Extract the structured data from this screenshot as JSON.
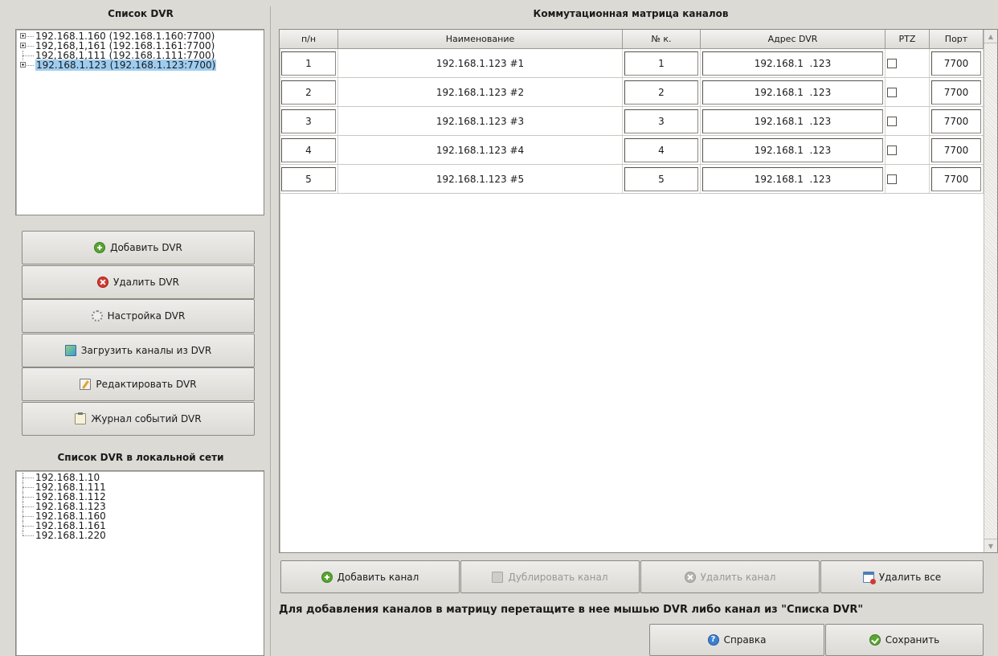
{
  "left": {
    "dvr_list_title": "Список DVR",
    "dvr_tree": [
      {
        "label": "192.168.1.160 (192.168.1.160:7700)",
        "expandable": true,
        "selected": false
      },
      {
        "label": "192,168,1,161 (192.168.1.161:7700)",
        "expandable": true,
        "selected": false
      },
      {
        "label": "192,168,1,111 (192.168.1.111:7700)",
        "expandable": false,
        "selected": false
      },
      {
        "label": "192.168.1.123 (192.168.1.123:7700)",
        "expandable": true,
        "selected": true
      }
    ],
    "buttons": {
      "add": "Добавить DVR",
      "delete": "Удалить DVR",
      "settings": "Настройка DVR",
      "load_channels": "Загрузить каналы из DVR",
      "edit": "Редактировать DVR",
      "event_log": "Журнал событий DVR"
    },
    "local_title": "Список DVR в локальной сети",
    "local_list": [
      "192.168.1.10",
      "192.168.1.111",
      "192.168.1.112",
      "192.168.1.123",
      "192.168.1.160",
      "192.168.1.161",
      "192.168.1.220"
    ]
  },
  "matrix": {
    "title": "Коммутационная матрица каналов",
    "columns": {
      "num": "п/н",
      "name": "Наименование",
      "ch": "№ к.",
      "addr": "Адрес DVR",
      "ptz": "PTZ",
      "port": "Порт"
    },
    "rows": [
      {
        "num": "1",
        "name": "192.168.1.123 #1",
        "ch": "1",
        "addr": "192.168.1  .123",
        "ptz": false,
        "port": "7700"
      },
      {
        "num": "2",
        "name": "192.168.1.123 #2",
        "ch": "2",
        "addr": "192.168.1  .123",
        "ptz": false,
        "port": "7700"
      },
      {
        "num": "3",
        "name": "192.168.1.123 #3",
        "ch": "3",
        "addr": "192.168.1  .123",
        "ptz": false,
        "port": "7700"
      },
      {
        "num": "4",
        "name": "192.168.1.123 #4",
        "ch": "4",
        "addr": "192.168.1  .123",
        "ptz": false,
        "port": "7700"
      },
      {
        "num": "5",
        "name": "192.168.1.123 #5",
        "ch": "5",
        "addr": "192.168.1  .123",
        "ptz": false,
        "port": "7700"
      }
    ],
    "buttons": {
      "add": "Добавить канал",
      "duplicate": "Дублировать канал",
      "delete": "Удалить канал",
      "delete_all": "Удалить все"
    },
    "hint": "Для добавления каналов в матрицу перетащите в нее мышью DVR либо канал из \"Списка DVR\""
  },
  "footer": {
    "help": "Справка",
    "save": "Сохранить"
  }
}
